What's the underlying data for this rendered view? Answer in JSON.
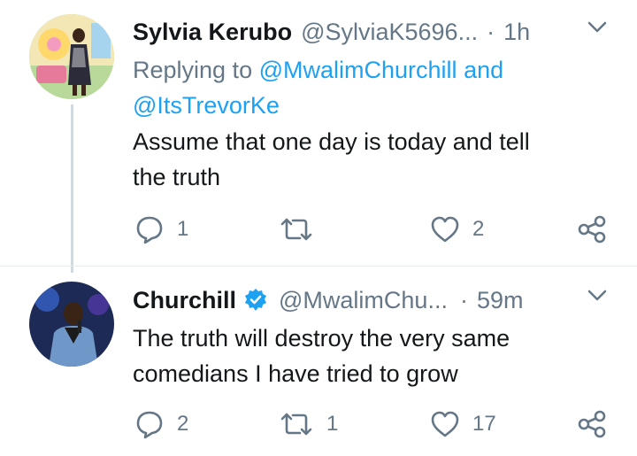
{
  "tweets": [
    {
      "name": "Sylvia Kerubo",
      "handle": "@SylviaK5696...",
      "separator": "·",
      "time": "1h",
      "replying_prefix": "Replying to",
      "replying_user1": "@MwalimChurchill",
      "replying_and": "and",
      "replying_user2": "@ItsTrevorKe",
      "text_line1": "Assume that one day is today and tell",
      "text_line2": "the truth",
      "reply_count": "1",
      "retweet_count": "",
      "like_count": "2"
    },
    {
      "name": "Churchill",
      "verified": true,
      "handle": "@MwalimChu...",
      "separator": "·",
      "time": "59m",
      "text_line1": "The truth will destroy the very same",
      "text_line2": "comedians I have tried to grow",
      "reply_count": "2",
      "retweet_count": "1",
      "like_count": "17"
    }
  ],
  "colors": {
    "link": "#1da1f2",
    "verified": "#1da1f2",
    "muted": "#657786"
  },
  "icons": [
    "reply-icon",
    "retweet-icon",
    "like-icon",
    "share-icon",
    "chevron-down-icon",
    "verified-badge-icon"
  ]
}
